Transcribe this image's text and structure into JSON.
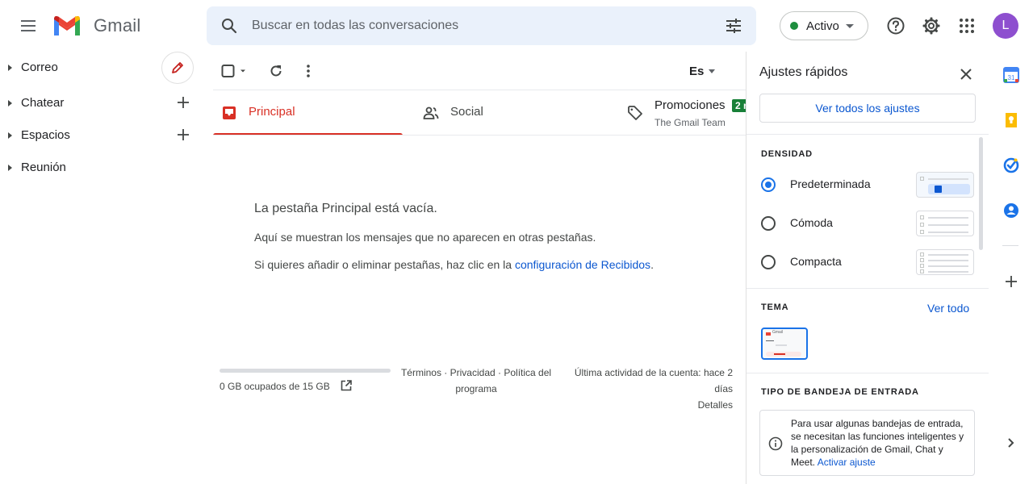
{
  "app": {
    "name": "Gmail"
  },
  "search": {
    "placeholder": "Buscar en todas las conversaciones"
  },
  "status": {
    "label": "Activo",
    "color": "#1e8e3e"
  },
  "account": {
    "initial": "L",
    "color": "#8e4fcf"
  },
  "sidebar": {
    "items": [
      {
        "label": "Correo"
      },
      {
        "label": "Chatear"
      },
      {
        "label": "Espacios"
      },
      {
        "label": "Reunión"
      }
    ]
  },
  "toolbar": {
    "input_tools_label": "Es"
  },
  "tabs": [
    {
      "label": "Principal",
      "active": true
    },
    {
      "label": "Social"
    },
    {
      "label": "Promociones",
      "subtitle": "The Gmail Team",
      "badge": "2 n"
    }
  ],
  "empty_state": {
    "title": "La pestaña Principal está vacía.",
    "line1": "Aquí se muestran los mensajes que no aparecen en otras pestañas.",
    "line2_prefix": "Si quieres añadir o eliminar pestañas, haz clic en la ",
    "line2_link": "configuración de Recibidos",
    "line2_suffix": "."
  },
  "footer": {
    "storage": "0 GB ocupados de 15 GB",
    "links": [
      "Términos",
      "Privacidad",
      "Política del programa"
    ],
    "link_separator": " · ",
    "activity": "Última actividad de la cuenta: hace 2 días",
    "details": "Detalles"
  },
  "quick_settings": {
    "title": "Ajustes rápidos",
    "all_settings_button": "Ver todos los ajustes",
    "density": {
      "heading": "DENSIDAD",
      "options": [
        {
          "label": "Predeterminada",
          "checked": true
        },
        {
          "label": "Cómoda"
        },
        {
          "label": "Compacta"
        }
      ]
    },
    "theme": {
      "heading": "TEMA",
      "view_all": "Ver todo",
      "thumbnail_text": "Gmail"
    },
    "inbox_type": {
      "heading": "TIPO DE BANDEJA DE ENTRADA",
      "info_text": "Para usar algunas bandejas de entrada, se necesitan las funciones inteligentes y la personalización de Gmail, Chat y Meet.",
      "info_link": "Activar ajuste"
    }
  },
  "apps_rail": {
    "calendar_label": "31",
    "icons": [
      "calendar-icon",
      "keep-icon",
      "tasks-icon",
      "contacts-icon",
      "plus-icon",
      "chevron-right-icon"
    ]
  }
}
